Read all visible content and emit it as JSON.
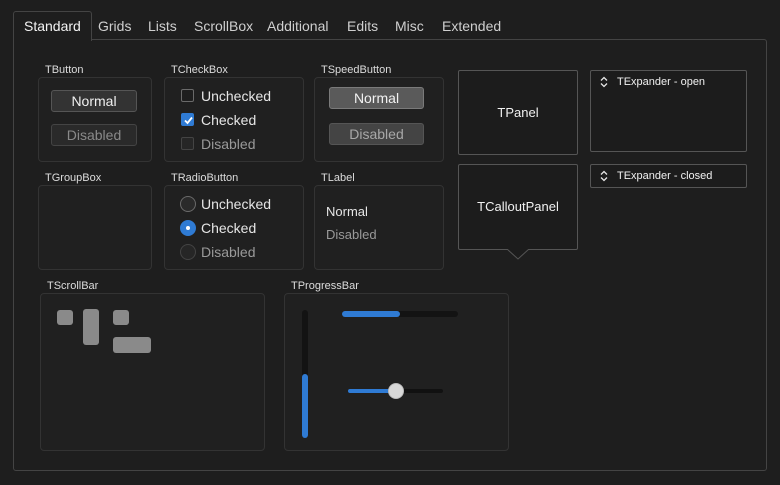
{
  "tabs": [
    {
      "label": "Standard",
      "active": true
    },
    {
      "label": "Grids"
    },
    {
      "label": "Lists"
    },
    {
      "label": "ScrollBox"
    },
    {
      "label": "Additional"
    },
    {
      "label": "Edits"
    },
    {
      "label": "Misc"
    },
    {
      "label": "Extended"
    }
  ],
  "tbutton": {
    "title": "TButton",
    "normal": "Normal",
    "disabled": "Disabled"
  },
  "tcheckbox": {
    "title": "TCheckBox",
    "unchecked": "Unchecked",
    "checked": "Checked",
    "disabled": "Disabled"
  },
  "tspeedbutton": {
    "title": "TSpeedButton",
    "normal": "Normal",
    "disabled": "Disabled"
  },
  "tpanel": {
    "label": "TPanel"
  },
  "tcalloutpanel": {
    "label": "TCalloutPanel"
  },
  "texpander_open": {
    "label": "TExpander - open"
  },
  "texpander_closed": {
    "label": "TExpander - closed"
  },
  "tgroupbox": {
    "title": "TGroupBox"
  },
  "tradiobutton": {
    "title": "TRadioButton",
    "unchecked": "Unchecked",
    "checked": "Checked",
    "disabled": "Disabled"
  },
  "tlabel": {
    "title": "TLabel",
    "normal": "Normal",
    "disabled": "Disabled"
  },
  "tscrollbar": {
    "title": "TScrollBar"
  },
  "tprogressbar": {
    "title": "TProgressBar",
    "vertical_value": 0.5,
    "horizontal_value": 0.5,
    "track_value": 0.5
  },
  "colors": {
    "accent": "#2f7bd4",
    "background": "#1e1e1e"
  }
}
